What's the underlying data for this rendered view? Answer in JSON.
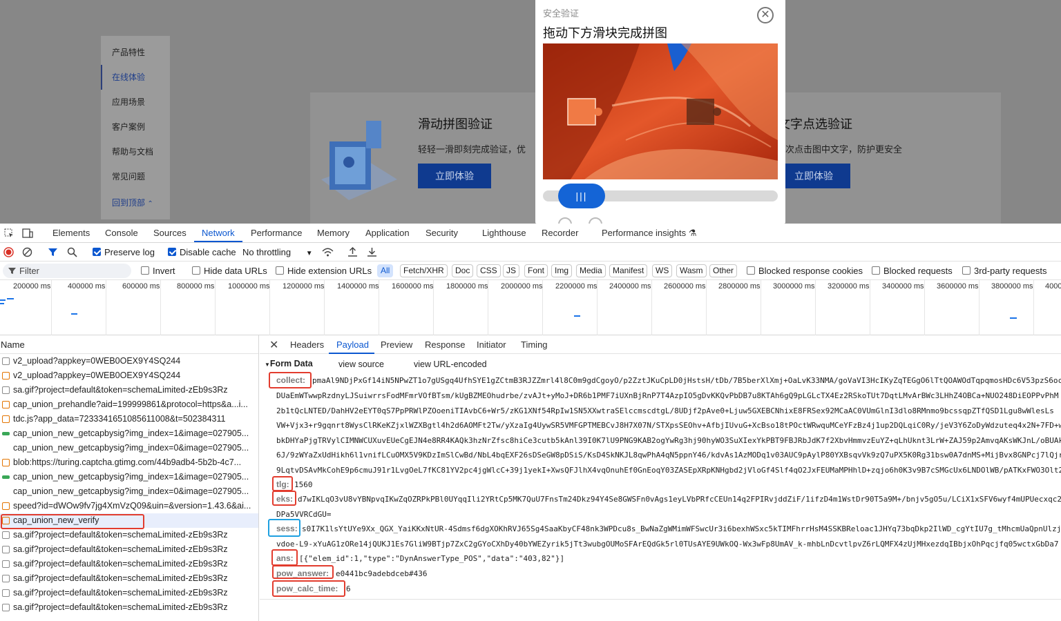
{
  "site": {
    "nav": [
      "产品特性",
      "在线体验",
      "应用场景",
      "客户案例",
      "帮助与文档",
      "常见问题",
      "回到顶部"
    ],
    "card1": {
      "title": "滑动拼图验证",
      "desc": "轻轻一滑即刻完成验证，优",
      "button": "立即体验"
    },
    "card2": {
      "title": "文字点选验证",
      "desc": "次点击图中文字，防护更安全",
      "button": "立即体验"
    }
  },
  "captcha": {
    "subtitle": "安全验证",
    "title": "拖动下方滑块完成拼图",
    "close": "✕",
    "handle": "|||"
  },
  "devtools": {
    "tabs": [
      "Elements",
      "Console",
      "Sources",
      "Network",
      "Performance",
      "Memory",
      "Application",
      "Security",
      "Lighthouse",
      "Recorder",
      "Performance insights"
    ],
    "active_tab": "Network",
    "toolbar": {
      "preserve_log": "Preserve log",
      "disable_cache": "Disable cache",
      "throttling": "No throttling"
    },
    "filter": {
      "placeholder": "Filter",
      "invert": "Invert",
      "hide_data_urls": "Hide data URLs",
      "hide_extension_urls": "Hide extension URLs",
      "chips": [
        "All",
        "Fetch/XHR",
        "Doc",
        "CSS",
        "JS",
        "Font",
        "Img",
        "Media",
        "Manifest",
        "WS",
        "Wasm",
        "Other"
      ],
      "blocked_cookies": "Blocked response cookies",
      "blocked_requests": "Blocked requests",
      "third_party": "3rd-party requests"
    },
    "overview_ticks": [
      "200000 ms",
      "400000 ms",
      "600000 ms",
      "800000 ms",
      "1000000 ms",
      "1200000 ms",
      "1400000 ms",
      "1600000 ms",
      "1800000 ms",
      "2000000 ms",
      "2200000 ms",
      "2400000 ms",
      "2600000 ms",
      "2800000 ms",
      "3000000 ms",
      "3200000 ms",
      "3400000 ms",
      "3600000 ms",
      "3800000 ms",
      "4000"
    ],
    "list_header": "Name",
    "requests": [
      {
        "name": "v2_upload?appkey=0WEB0OEX9Y4SQ244",
        "icon": "doc"
      },
      {
        "name": "v2_upload?appkey=0WEB0OEX9Y4SQ244",
        "icon": "script"
      },
      {
        "name": "sa.gif?project=default&token=schemaLimited-zEb9s3Rz",
        "icon": "doc"
      },
      {
        "name": "cap_union_prehandle?aid=199999861&protocol=https&a...i...",
        "icon": "script"
      },
      {
        "name": "tdc.js?app_data=7233341651085611008&t=502384311",
        "icon": "script"
      },
      {
        "name": "cap_union_new_getcapbysig?img_index=1&image=027905...",
        "icon": "img"
      },
      {
        "name": "cap_union_new_getcapbysig?img_index=0&image=027905...",
        "icon": "none"
      },
      {
        "name": "blob:https://turing.captcha.gtimg.com/44b9adb4-5b2b-4c7...",
        "icon": "script"
      },
      {
        "name": "cap_union_new_getcapbysig?img_index=1&image=027905...",
        "icon": "img"
      },
      {
        "name": "cap_union_new_getcapbysig?img_index=0&image=027905...",
        "icon": "none"
      },
      {
        "name": "speed?id=dWOw9fv7jg4XmVzQ09&uin=&version=1.43.6&ai...",
        "icon": "script"
      },
      {
        "name": "cap_union_new_verify",
        "icon": "script"
      },
      {
        "name": "sa.gif?project=default&token=schemaLimited-zEb9s3Rz",
        "icon": "doc"
      },
      {
        "name": "sa.gif?project=default&token=schemaLimited-zEb9s3Rz",
        "icon": "doc"
      },
      {
        "name": "sa.gif?project=default&token=schemaLimited-zEb9s3Rz",
        "icon": "doc"
      },
      {
        "name": "sa.gif?project=default&token=schemaLimited-zEb9s3Rz",
        "icon": "doc"
      },
      {
        "name": "sa.gif?project=default&token=schemaLimited-zEb9s3Rz",
        "icon": "doc"
      },
      {
        "name": "sa.gif?project=default&token=schemaLimited-zEb9s3Rz",
        "icon": "doc"
      }
    ],
    "selected_request": "cap_union_new_verify",
    "detail_tabs": [
      "Headers",
      "Payload",
      "Preview",
      "Response",
      "Initiator",
      "Timing"
    ],
    "active_detail_tab": "Payload",
    "form": {
      "heading": "Form Data",
      "view_source": "view source",
      "view_url_encoded": "view URL-encoded",
      "collect_key": "collect:",
      "collect_lines": [
        "pmaAl9NDjPxGf14iN5NPwZT1o7gUSgq4UfhSYE1gZCtmB3RJZZmrl4l8C0m9gdCgoyO/p2ZztJKuCpLD0jHstsH/tDb/7B5berXlXmj+OaLvK33NMA/goVaVI3HcIKyZqTEGgO6lTtQOAWOdTqpqmosHDc6V53pzS6oc",
        "DUaEmWTwwpRzdnyLJSuiwrrsFodMFmrVOfBTsm/kUgBZMEOhudrbe/zvAJt+yMoJ+DR6b1PMF7iUXnBjRnP7T4AzpIO5gDvKKQvPbDB7u8KTAh6gQ9pLGLcTX4Ez2RSkoTUt7DqtLMvArBWc3LHhZ4OBCa+NUO248DiEOPPvPhM",
        "2b1tQcLNTED/DahHV2eEYT0qS7PpPRWlPZOoeniTIAvbC6+Wr5/zKG1XNf54RpIw1SN5XXwtraSElccmscdtgL/8UDjf2pAve0+Ljuw5GXEBCNhixE8FRSex92MCaAC0VUmGlnI3dlo8RMnmo9bcssqpZTfQSD1Lgu8wWlesLs",
        "VW+Vjx3+r9gqnrt8WysClRKeKZjxlWZXBgtl4h2d6AOMFt2Tw/yXzaIg4UywSR5VMFGPTMEBCvJ8H7X07N/STXpsSEOhv+AfbjIUvuG+XcBso18tPOctWRwquMCeYFzBz4j1up2DQLqiC0Ry/jeV3Y6ZoDyWdzuteq4x2N+7FD+w",
        "bkDHYaPjgTRVylCIMNWCUXuvEUeCgEJN4e8RR4KAQk3hzNrZfsc8hiCe3cutb5kAnl39I0K7lU9PNG9KAB2ogYwRg3hj90hyWO3SuXIexYkPBT9FBJRbJdK7f2XbvHmmvzEuYZ+qLhUknt3LrW+ZAJ59p2AmvqAKsWKJnL/oBUAk",
        "6J/9zWYaZxUdHikh6l1vnifLCuOMX5V9KDzImSlCwBd/NbL4bqEXF26sDSeGW8pDSiS/KsD4SkNKJL8qwPhA4qN5ppnY46/kdvAs1AzMODq1v03AUC9pAylP80YXBsqvVk9zQ7uPX5K0Rg31bsw0A7dnMS+MijBvx8GNPcj7lQjr",
        "9LqtvDSAvMkCohE9p6cmuJ91r1LvgOeL7fKC81YV2pc4jgWlcC+39j1yekI+XwsQFJlhX4vqOnuhEf0GnEoqY03ZASEpXRpKNHgbd2jVloGf4Slf4qO2JxFEUMaMPHhlD+zqjo6h0K3v9B7cSMGcUx6LNDOlWB/pATKxFWO3Olt2"
      ],
      "tlg_key": "tlg:",
      "tlg": "1560",
      "eks_key": "eks:",
      "eks_lines": [
        "d7wIKLqO3vU8vYBNpvqIKwZqOZRPkPBl0UYqqIli2YRtCp5MK7QuU7FnsTm24Dkz94Y4Se8GWSFn0vAgs1eyLVbPRfcCEUn14q2FPIRvjddZiF/1ifzD4m1WstDr90T5a9M+/bnjv5gO5u/LCiX1xSFV6wyf4mUPUecxqc2/s",
        "DPa5VVRCdGU="
      ],
      "sess_key": "sess:",
      "sess_lines": [
        "s0I7K1lsYtUYe9Xx_QGX_YaiKKxNtUR-4Sdmsf6dgXOKhRVJ65Sg4SaaKbyCF48nk3WPDcu8s_BwNaZgWMimWFSwcUr3i6bexhWSxc5kTIMFhrrHsM4SSKBReloac1JHYq73bqDkp2IlWD_cgYtIU7g_tMhcmUaQpnUlzjK",
        "vdoe-L9-xYuAG1zORe14jQUKJ1Es7GliW9BTjp7ZxC2gGYoCXhDy40bYWEZyrik5jTt3wubgOUMoSFArEQdGk5rl0TUsAYE9UWkOQ-Wx3wFp8UmAV_k-mhbLnDcvtlpvZ6rLQMFX4zUjMHxezdqIBbjxOhPqcjfq05wctxGbDa7"
      ],
      "ans_key": "ans:",
      "ans": "[{\"elem_id\":1,\"type\":\"DynAnswerType_POS\",\"data\":\"403,82\"}]",
      "pow_answer_key": "pow_answer:",
      "pow_answer": "e0441bc9adebdceb#436",
      "pow_calc_time_key": "pow_calc_time:",
      "pow_calc_time": "6"
    }
  }
}
